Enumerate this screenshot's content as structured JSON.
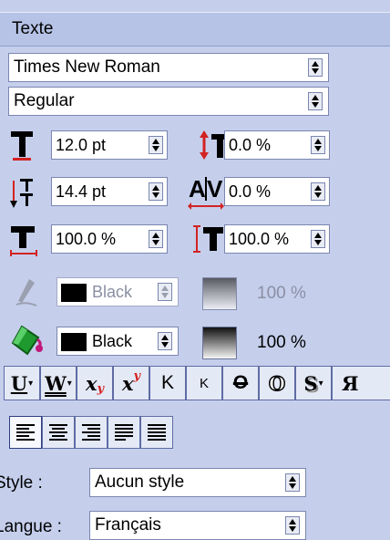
{
  "panel": {
    "title": "Texte"
  },
  "font": {
    "family": "Times New Roman",
    "style": "Regular"
  },
  "metrics": {
    "size": "12.0 pt",
    "baseline_shift": "0.0 %",
    "leading": "14.4 pt",
    "kerning": "0.0 %",
    "horizontal_scale": "100.0 %",
    "vertical_scale": "100.0 %"
  },
  "stroke": {
    "color": "Black",
    "opacity": "100 %"
  },
  "fill": {
    "color": "Black",
    "opacity": "100 %"
  },
  "format_buttons": [
    "U",
    "W",
    "x",
    "x",
    "K",
    "K",
    "O",
    "O",
    "S",
    "Я"
  ],
  "paragraph_style": {
    "label": "Style :",
    "value": "Aucun style"
  },
  "language": {
    "label": "Langue :",
    "value": "Français"
  },
  "colors": {
    "panel_bg": "#C5CFEC",
    "title_bg": "#B6C3E6",
    "accent_red": "#D32222"
  }
}
